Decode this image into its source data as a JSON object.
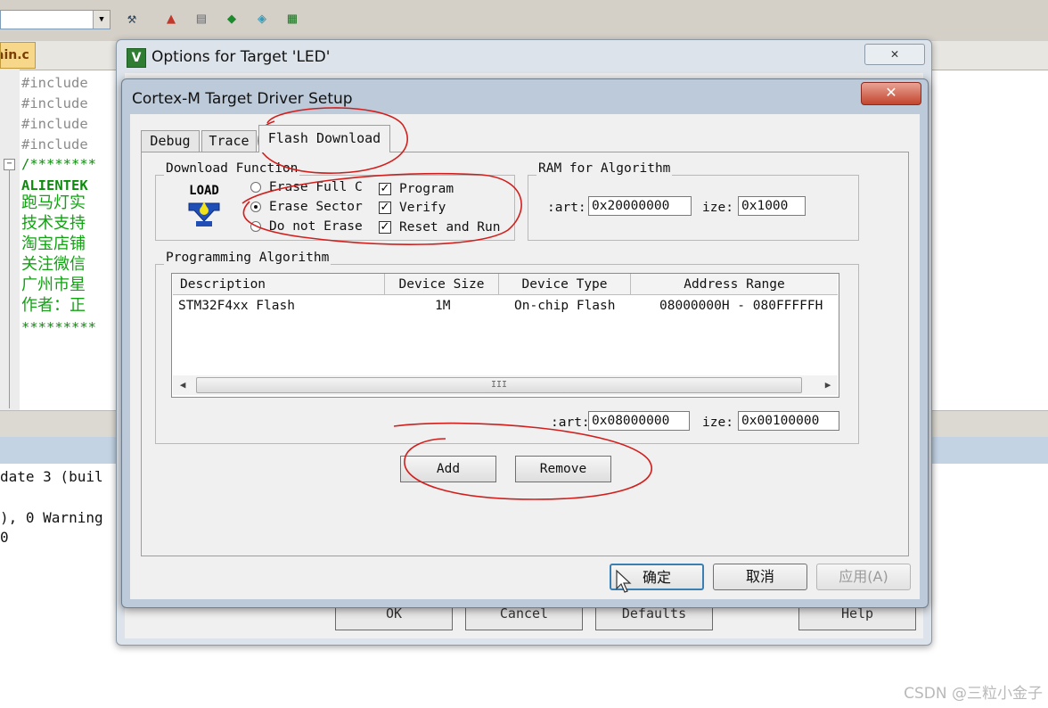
{
  "ide": {
    "file_tab": "ain.c",
    "code_lines": [
      "#include",
      "#include",
      "#include",
      "#include",
      "/********",
      "ALIENTEK",
      "跑马灯实",
      "技术支持",
      "淘宝店铺",
      "关注微信",
      "广州市星",
      "作者：正",
      "*********"
    ],
    "build_lines": [
      "date 3 (buil",
      "), 0 Warning",
      "0"
    ]
  },
  "outer_dialog": {
    "title": "Options for Target 'LED'",
    "close_label": "✕",
    "buttons": [
      "OK",
      "Cancel",
      "Defaults",
      "Help"
    ]
  },
  "inner_dialog": {
    "title": "Cortex-M Target Driver Setup",
    "close_label": "✕",
    "tabs": [
      "Debug",
      "Trace",
      "Flash Download"
    ],
    "download_function": {
      "label": "Download Function",
      "load_icon_text": "LOAD",
      "radios": [
        {
          "label": "Erase Full C",
          "selected": false
        },
        {
          "label": "Erase Sector",
          "selected": true
        },
        {
          "label": "Do not Erase",
          "selected": false
        }
      ],
      "checks": [
        {
          "label": "Program",
          "checked": true
        },
        {
          "label": "Verify",
          "checked": true
        },
        {
          "label": "Reset and Run",
          "checked": true
        }
      ]
    },
    "ram": {
      "label": "RAM for Algorithm",
      "start_label": ":art:",
      "start_value": "0x20000000",
      "size_label": "ize:",
      "size_value": "0x1000"
    },
    "programming_algorithm": {
      "label": "Programming Algorithm",
      "columns": [
        "Description",
        "Device Size",
        "Device Type",
        "Address Range"
      ],
      "rows": [
        {
          "description": "STM32F4xx Flash",
          "size": "1M",
          "type": "On-chip Flash",
          "range": "08000000H - 080FFFFFH"
        }
      ],
      "scroll_grip": "III",
      "start_label": ":art:",
      "start_value": "0x08000000",
      "size_label": "ize:",
      "size_value": "0x00100000"
    },
    "add_label": "Add",
    "remove_label": "Remove",
    "confirm_label": "确定",
    "cancel_label": "取消",
    "apply_label": "应用(A)"
  },
  "watermark": "CSDN @三粒小金子",
  "colors": {
    "annotation_red": "#d0201e",
    "code_green": "#0f8a0f",
    "window_frame": "#bccad9"
  }
}
